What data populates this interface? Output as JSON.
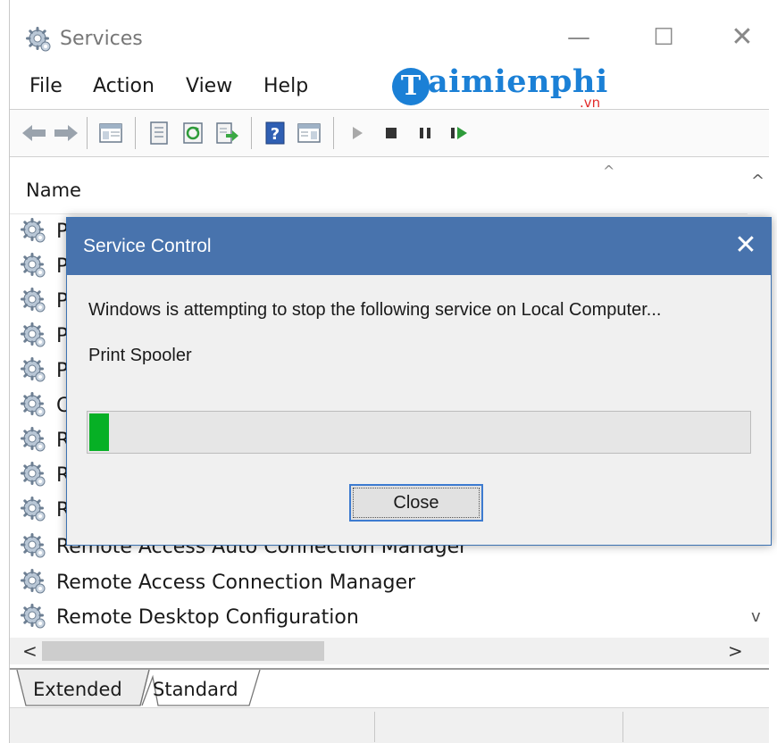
{
  "window": {
    "title": "Services",
    "controls": {
      "minimize": "—",
      "maximize": "☐",
      "close": "✕"
    }
  },
  "menu": [
    "File",
    "Action",
    "View",
    "Help"
  ],
  "watermark": {
    "logo_letter": "T",
    "text": "aimienphi",
    "suffix": ".vn"
  },
  "toolbar": [
    "back-arrow-icon",
    "forward-arrow-icon",
    "show-hide-console-tree-icon",
    "properties-icon",
    "refresh-icon",
    "export-list-icon",
    "help-icon",
    "show-hide-action-pane-icon",
    "start-service-icon",
    "stop-service-icon",
    "pause-service-icon",
    "restart-service-icon"
  ],
  "list": {
    "column": "Name",
    "sort_indicator": "^",
    "rows": [
      "P",
      "P",
      "P",
      "P",
      "P",
      "C",
      "R",
      "R",
      "R",
      "Remote Access Auto Connection Manager",
      "Remote Access Connection Manager",
      "Remote Desktop Configuration"
    ],
    "scroll_up": "^",
    "scroll_down": "v",
    "scroll_left": "<",
    "scroll_right": ">"
  },
  "tabs": [
    "Extended",
    "Standard"
  ],
  "dialog": {
    "title": "Service Control",
    "close": "✕",
    "message": "Windows is attempting to stop the following service on Local Computer...",
    "service": "Print Spooler",
    "progress": 0.03,
    "button": "Close"
  },
  "colors": {
    "dialog_title": "#4873ad",
    "progress": "#06b025",
    "watermark": "#1b80d6"
  }
}
